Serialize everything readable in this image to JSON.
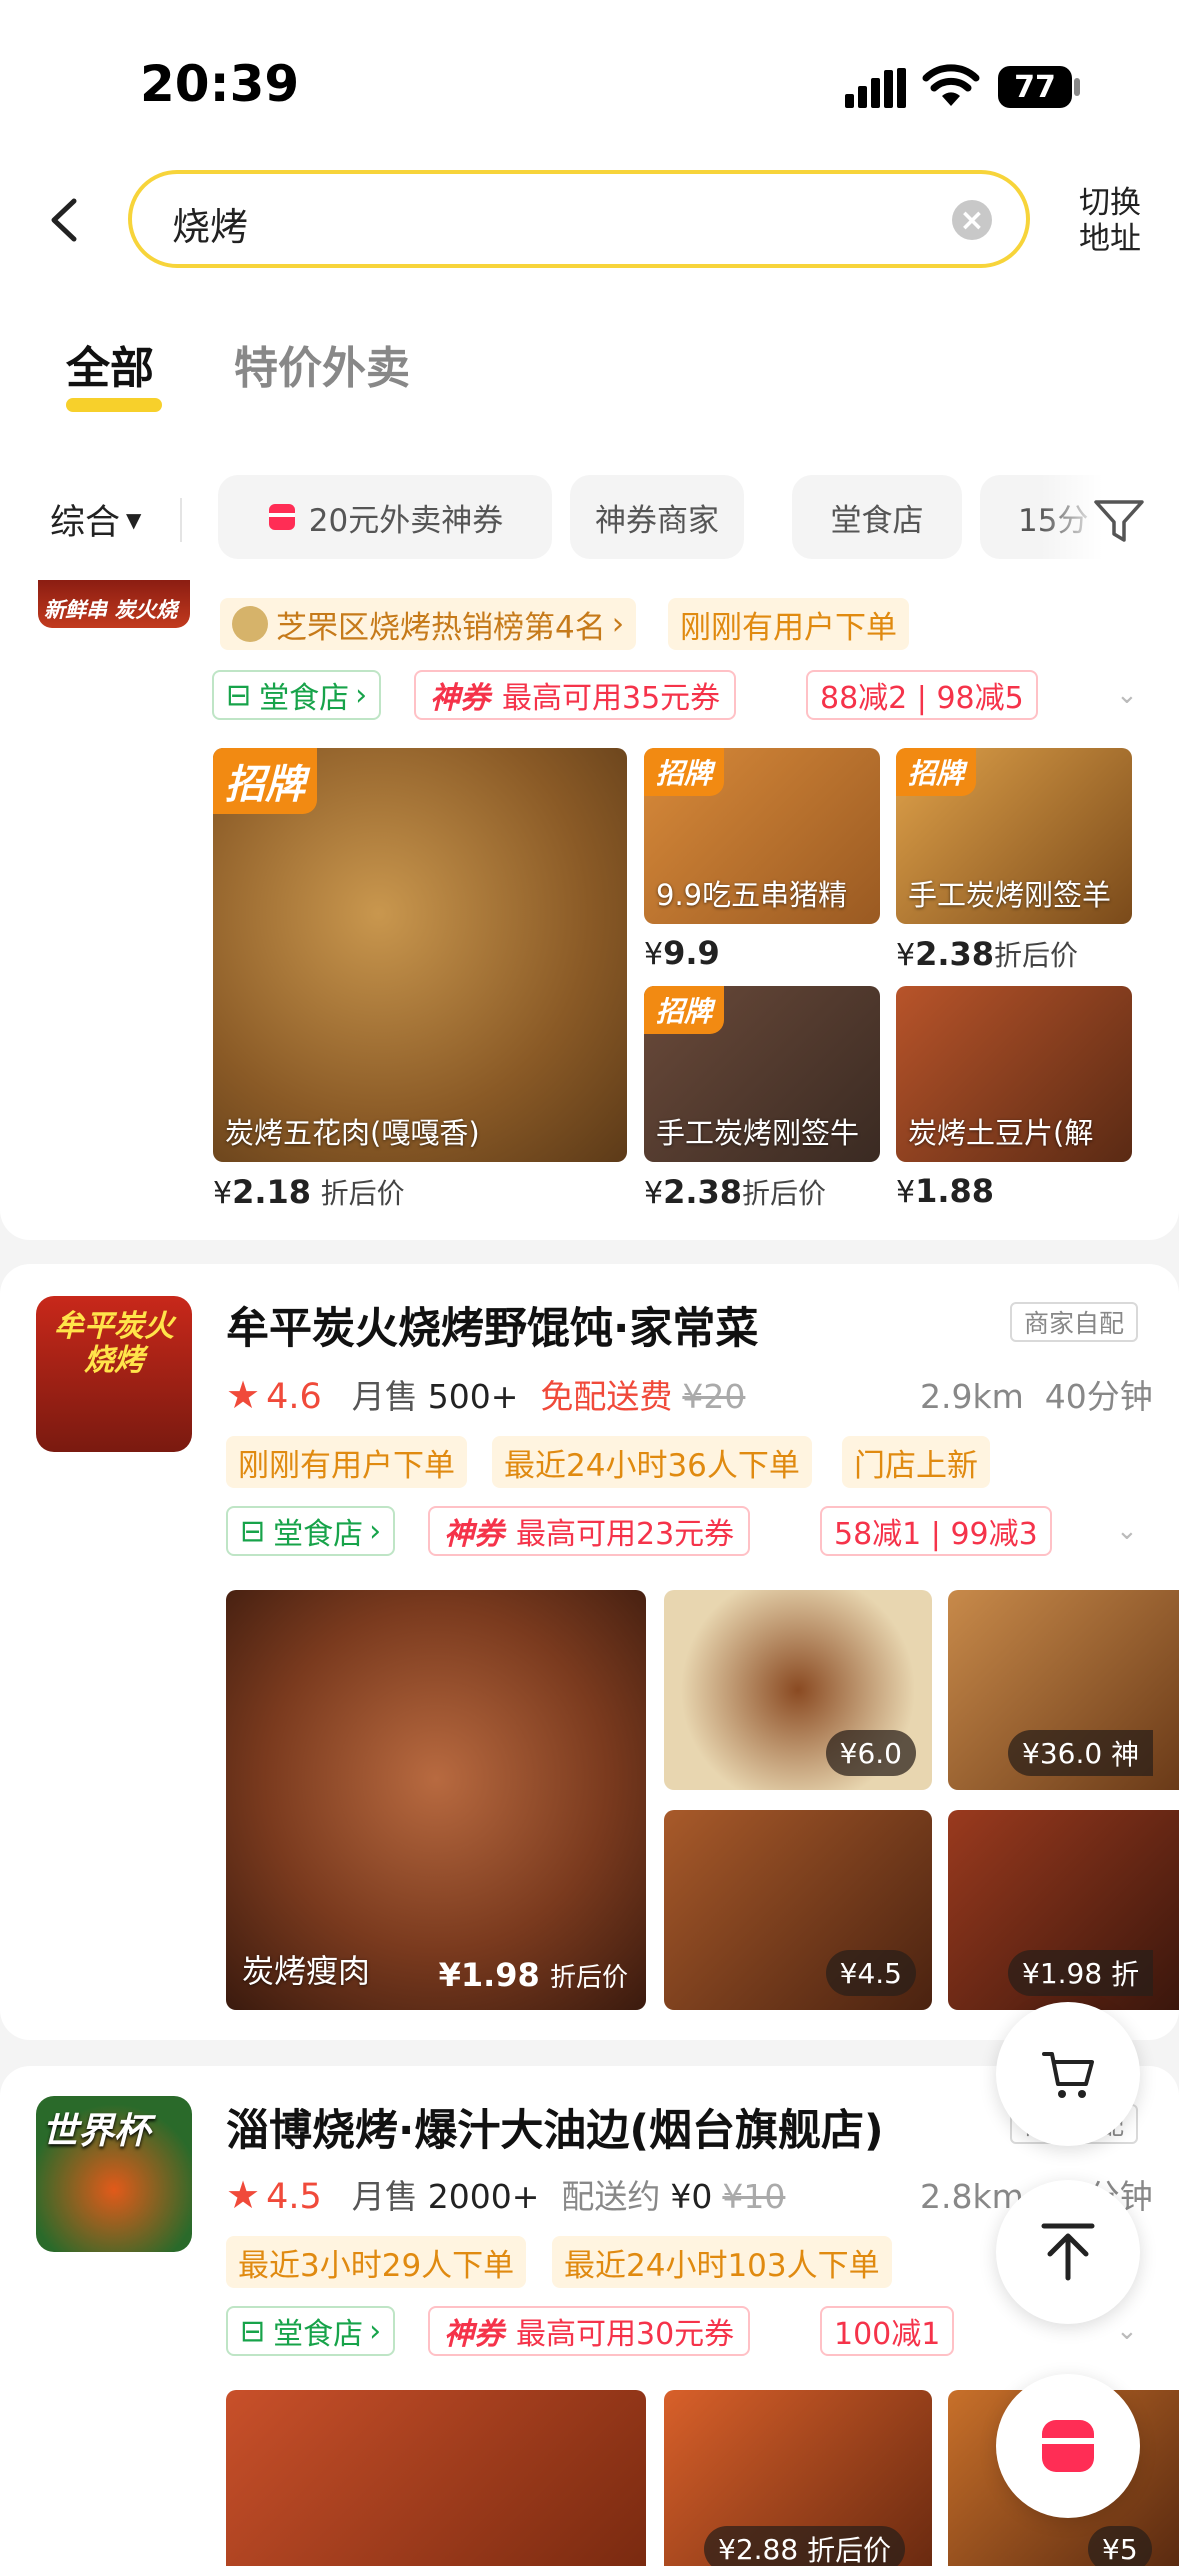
{
  "status_bar": {
    "time": "20:39",
    "battery": "77"
  },
  "search": {
    "query": "烧烤",
    "switch_address": "切换地址"
  },
  "tabs": [
    {
      "label": "全部"
    },
    {
      "label": "特价外卖"
    }
  ],
  "filters": {
    "sort": "综合",
    "chips": [
      "20元外卖神券",
      "神券商家",
      "堂食店",
      "15分"
    ]
  },
  "shops": [
    {
      "logo_text": "新鲜串 炭火烧",
      "rank_tag": "芝罘区烧烤热销榜第4名",
      "tags": [
        "刚刚有用户下单"
      ],
      "dine_in": "堂食店",
      "coupon_badge": "神券",
      "coupon": "最高可用35元券",
      "discount": "88减2 | 98减5",
      "dishes": [
        {
          "name": "炭烤五花肉(嘎嘎香)",
          "price": "2.18",
          "price_note": "折后价",
          "badge": "招牌"
        },
        {
          "name": "9.9吃五串猪精",
          "price": "9.9",
          "price_note": "",
          "badge": "招牌"
        },
        {
          "name": "手工炭烤刚签羊",
          "price": "2.38",
          "price_note": "折后价",
          "badge": "招牌"
        },
        {
          "name": "手工炭烤刚签牛",
          "price": "2.38",
          "price_note": "折后价",
          "badge": "招牌"
        },
        {
          "name": "炭烤土豆片(解",
          "price": "1.88",
          "price_note": "",
          "badge": ""
        }
      ]
    },
    {
      "logo_text": "牟平炭火烧烤",
      "name": "牟平炭火烧烤野馄饨·家常菜",
      "delivery_type": "商家自配",
      "rating": "4.6",
      "sold_label": "月售",
      "sold": "500+",
      "shipping": "免配送费",
      "orig_fee": "¥20",
      "distance": "2.9km",
      "time": "40分钟",
      "tags": [
        "刚刚有用户下单",
        "最近24小时36人下单",
        "门店上新"
      ],
      "dine_in": "堂食店",
      "coupon_badge": "神券",
      "coupon": "最高可用23元券",
      "discount": "58减1 | 99减3",
      "dishes": [
        {
          "name": "炭烤瘦肉",
          "price": "¥1.98",
          "price_note": "折后价"
        },
        {
          "name": "",
          "price": "¥6.0",
          "price_note": ""
        },
        {
          "name": "",
          "price": "¥36.0",
          "price_note": "神"
        },
        {
          "name": "",
          "price": "¥4.5",
          "price_note": ""
        },
        {
          "name": "",
          "price": "¥1.98",
          "price_note": "折"
        }
      ]
    },
    {
      "logo_text": "世界杯",
      "name": "淄博烧烤·爆汁大油边(烟台旗舰店)",
      "delivery_type": "商家自配",
      "rating": "4.5",
      "sold_label": "月售",
      "sold": "2000+",
      "shipping": "配送约",
      "fee": "¥0",
      "orig_fee": "¥10",
      "distance": "2.8km",
      "time": "35分钟",
      "tags": [
        "最近3小时29人下单",
        "最近24小时103人下单"
      ],
      "dine_in": "堂食店",
      "coupon_badge": "神券",
      "coupon": "最高可用30元券",
      "discount": "100减1",
      "dishes": [
        {
          "price": "¥2.88",
          "price_note": "折后价"
        },
        {
          "price": "¥5",
          "price_note": ""
        }
      ]
    }
  ]
}
